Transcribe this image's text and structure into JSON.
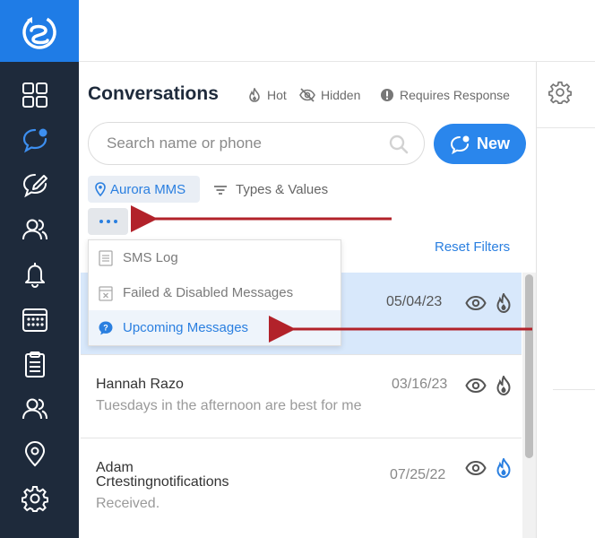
{
  "sidebar": {
    "logo": "app-logo",
    "items": [
      {
        "name": "dashboard-grid-icon",
        "active": false
      },
      {
        "name": "conversations-icon",
        "active": true
      },
      {
        "name": "compose-message-icon",
        "active": false
      },
      {
        "name": "contacts-icon",
        "active": false
      },
      {
        "name": "notifications-bell-icon",
        "active": false
      },
      {
        "name": "calendar-icon",
        "active": false
      },
      {
        "name": "clipboard-icon",
        "active": false
      },
      {
        "name": "team-icon",
        "active": false
      },
      {
        "name": "location-pin-icon",
        "active": false
      },
      {
        "name": "settings-gear-icon",
        "active": false
      }
    ]
  },
  "conversations": {
    "title": "Conversations",
    "filters": {
      "hot": "Hot",
      "hidden": "Hidden",
      "requires_response": "Requires Response"
    },
    "search": {
      "placeholder": "Search name or phone",
      "value": ""
    },
    "new_button": "New",
    "location_chip": "Aurora MMS",
    "types_values": "Types & Values",
    "reset_filters": "Reset Filters"
  },
  "dropdown": {
    "items": [
      {
        "label": "SMS Log",
        "icon": "log-icon",
        "active": false
      },
      {
        "label": "Failed & Disabled Messages",
        "icon": "failed-message-icon",
        "active": false
      },
      {
        "label": "Upcoming Messages",
        "icon": "upcoming-clock-icon",
        "active": true
      }
    ]
  },
  "conversation_list": [
    {
      "name": "",
      "preview": "",
      "date": "05/04/23",
      "hot_color": "#555555",
      "selected": true
    },
    {
      "name": "Hannah Razo",
      "preview": "Tuesdays in the afternoon are best for me",
      "date": "03/16/23",
      "hot_color": "#555555",
      "selected": false
    },
    {
      "name": "Adam\nCrtestingnotifications",
      "name_line1": "Adam",
      "name_line2": "Crtestingnotifications",
      "preview": "Received.",
      "date": "07/25/22",
      "hot_color": "#2a7fe0",
      "selected": false
    }
  ],
  "colors": {
    "sidebar_bg": "#1e2a3b",
    "brand_blue": "#1f7ce6",
    "accent": "#2a86ec",
    "annotation_arrow": "#b2222a"
  }
}
